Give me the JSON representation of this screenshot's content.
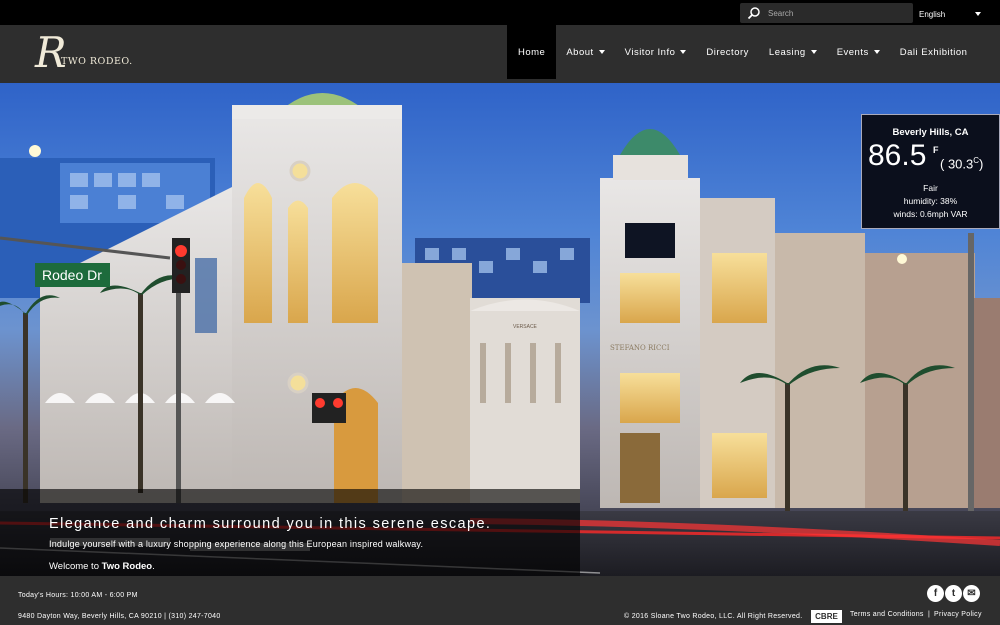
{
  "search": {
    "placeholder": "Search"
  },
  "language": {
    "selected": "English"
  },
  "brand": {
    "mark": "R",
    "name": "TWO RODEO."
  },
  "nav": {
    "items": [
      {
        "label": "Home",
        "active": true,
        "dropdown": false
      },
      {
        "label": "About",
        "dropdown": true
      },
      {
        "label": "Visitor Info",
        "dropdown": true
      },
      {
        "label": "Directory",
        "dropdown": false
      },
      {
        "label": "Leasing",
        "dropdown": true
      },
      {
        "label": "Events",
        "dropdown": true
      },
      {
        "label": "Dali Exhibition",
        "dropdown": false
      }
    ]
  },
  "hero": {
    "street_sign": "Rodeo Dr",
    "store_sign_1": "VERSACE",
    "store_sign_2": "STEFANO RICCI"
  },
  "weather": {
    "city": "Beverly Hills, CA",
    "temp_f": "86.5",
    "unit_f": "F",
    "temp_c": "( 30.3",
    "unit_c": "C",
    "temp_c_close": ")",
    "condition": "Fair",
    "humidity": "humidity: 38%",
    "winds": "winds: 0.6mph VAR"
  },
  "caption": {
    "headline": "Elegance and charm surround you in this serene escape.",
    "subline": "Indulge yourself with a luxury shopping experience along this European inspired walkway.",
    "welcome_prefix": "Welcome to ",
    "welcome_name": "Two Rodeo",
    "welcome_suffix": "."
  },
  "footer": {
    "hours": "Today's Hours: 10:00 AM - 6:00 PM",
    "address": "9480 Dayton Way, Beverly Hills, CA 90210 | (310) 247-7040",
    "copyright": "© 2016 Sloane Two Rodeo, LLC. All Right Reserved.",
    "cbre": "CBRE",
    "terms": "Terms and Conditions",
    "separator": "|",
    "privacy": "Privacy Policy",
    "social": [
      "facebook-icon",
      "twitter-icon",
      "email-icon"
    ]
  },
  "colors": {
    "nav_bg": "#2e2e2e",
    "topbar_bg": "#000000",
    "logo_cream": "#f0ead8"
  }
}
